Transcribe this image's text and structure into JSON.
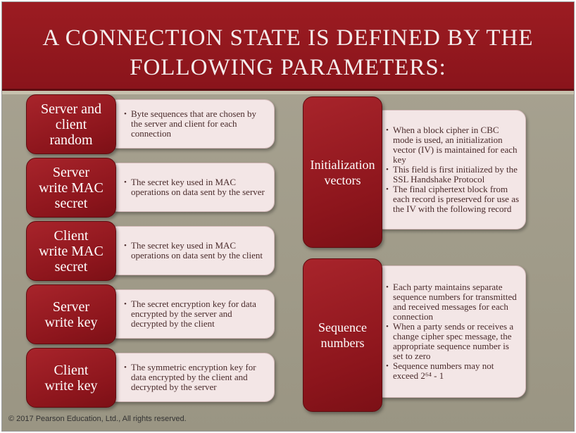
{
  "slide": {
    "title_line1": "A connection state is defined by the",
    "title_line2": "following parameters:",
    "footer": "© 2017 Pearson Education, Ltd., All rights reserved."
  },
  "left_items": [
    {
      "label_lines": [
        "Server and",
        "client",
        "random"
      ],
      "bullets": [
        "Byte sequences that are chosen by the server and client for each connection"
      ]
    },
    {
      "label_lines": [
        "Server",
        "write MAC",
        "secret"
      ],
      "bullets": [
        "The secret key used in MAC operations on data sent by the server"
      ]
    },
    {
      "label_lines": [
        "Client",
        "write MAC",
        "secret"
      ],
      "bullets": [
        "The secret key used in MAC operations on data sent by the client"
      ]
    },
    {
      "label_lines": [
        "Server",
        "write key"
      ],
      "bullets": [
        "The secret encryption key for data encrypted by the server and decrypted by the client"
      ]
    },
    {
      "label_lines": [
        "Client",
        "write key"
      ],
      "bullets": [
        "The symmetric encryption key for data encrypted by the client and decrypted by the server"
      ]
    }
  ],
  "right_items": [
    {
      "label_lines": [
        "Initialization",
        "vectors"
      ],
      "bullets": [
        "When a block cipher in CBC mode is used, an initialization vector (IV) is maintained for each key",
        "This field is first initialized by the SSL Handshake Protocol",
        "The final ciphertext block from each record is preserved for use as the IV with the following record"
      ]
    },
    {
      "label_lines": [
        "Sequence",
        "numbers"
      ],
      "bullets": [
        "Each party maintains separate sequence numbers for transmitted and received messages for each connection",
        "When a party sends or receives a change cipher spec message, the appropriate sequence number is set to zero",
        "Sequence numbers may not exceed 2⁶⁴ - 1"
      ]
    }
  ]
}
